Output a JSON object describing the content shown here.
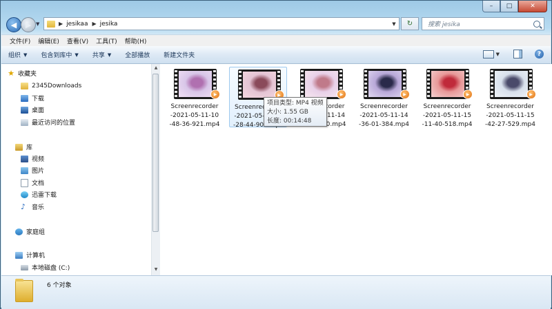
{
  "window": {
    "caption_buttons": [
      "–",
      "□",
      "✕"
    ]
  },
  "address": {
    "crumbs": [
      "jesikaa",
      "jesika"
    ],
    "search_placeholder": "搜索 jesika"
  },
  "menu": [
    "文件(F)",
    "编辑(E)",
    "查看(V)",
    "工具(T)",
    "帮助(H)"
  ],
  "commands": {
    "organize": "组织",
    "include_library": "包含到库中",
    "share": "共享",
    "play_all": "全部播放",
    "new_folder": "新建文件夹",
    "help": "?"
  },
  "nav": {
    "favorites": "收藏夹",
    "fav_items": [
      "2345Downloads",
      "下载",
      "桌面",
      "最近访问的位置"
    ],
    "libraries": "库",
    "lib_items": [
      "视频",
      "图片",
      "文档",
      "迅雷下载",
      "音乐"
    ],
    "homegroup": "家庭组",
    "computer": "计算机",
    "computer_items": [
      "本地磁盘 (C:)"
    ]
  },
  "files": [
    {
      "name": "Screenrecorder-2021-05-11-10-48-36-921.mp4",
      "thumb": [
        "#d8c6e8",
        "#b070b0",
        "#f0e0f4"
      ]
    },
    {
      "name": "Screenrecorder-2021-05-11-14-28-44-902.mp4",
      "thumb": [
        "#e4c4d4",
        "#8a4a5a",
        "#f4d8e0"
      ]
    },
    {
      "name": "Screenrecorder-2021-05-11-14-31-42-190.mp4",
      "thumb": [
        "#e8d0e8",
        "#c07a8a",
        "#f8e8f0"
      ]
    },
    {
      "name": "Screenrecorder-2021-05-11-14-36-01-384.mp4",
      "thumb": [
        "#b8a8d8",
        "#2a2a4a",
        "#e0d8f0"
      ]
    },
    {
      "name": "Screenrecorder-2021-05-11-15-11-40-518.mp4",
      "thumb": [
        "#e89898",
        "#c02a3a",
        "#f4d0d0"
      ]
    },
    {
      "name": "Screenrecorder-2021-05-11-15-42-27-529.mp4",
      "thumb": [
        "#d8e0ec",
        "#4a4a6a",
        "#f0f4f8"
      ]
    }
  ],
  "visible_names": [
    "Screenrecorder\n-2021-05-11-10\n-48-36-921.mp4",
    "Screenrecorder\n-2021-05-11-14\n-28-44-902.mp4",
    "Screenrecorder\n-2021-05-11-14\n-31-42-190.mp4",
    "Screenrecorder\n-2021-05-11-14\n-36-01-384.mp4",
    "Screenrecorder\n-2021-05-11-15\n-11-40-518.mp4",
    "Screenrecorder\n-2021-05-11-15\n-42-27-529.mp4"
  ],
  "tooltip": {
    "type": "项目类型: MP4 视频",
    "size": "大小: 1.55 GB",
    "length": "长度: 00:14:48"
  },
  "status": {
    "count": "6 个对象"
  }
}
